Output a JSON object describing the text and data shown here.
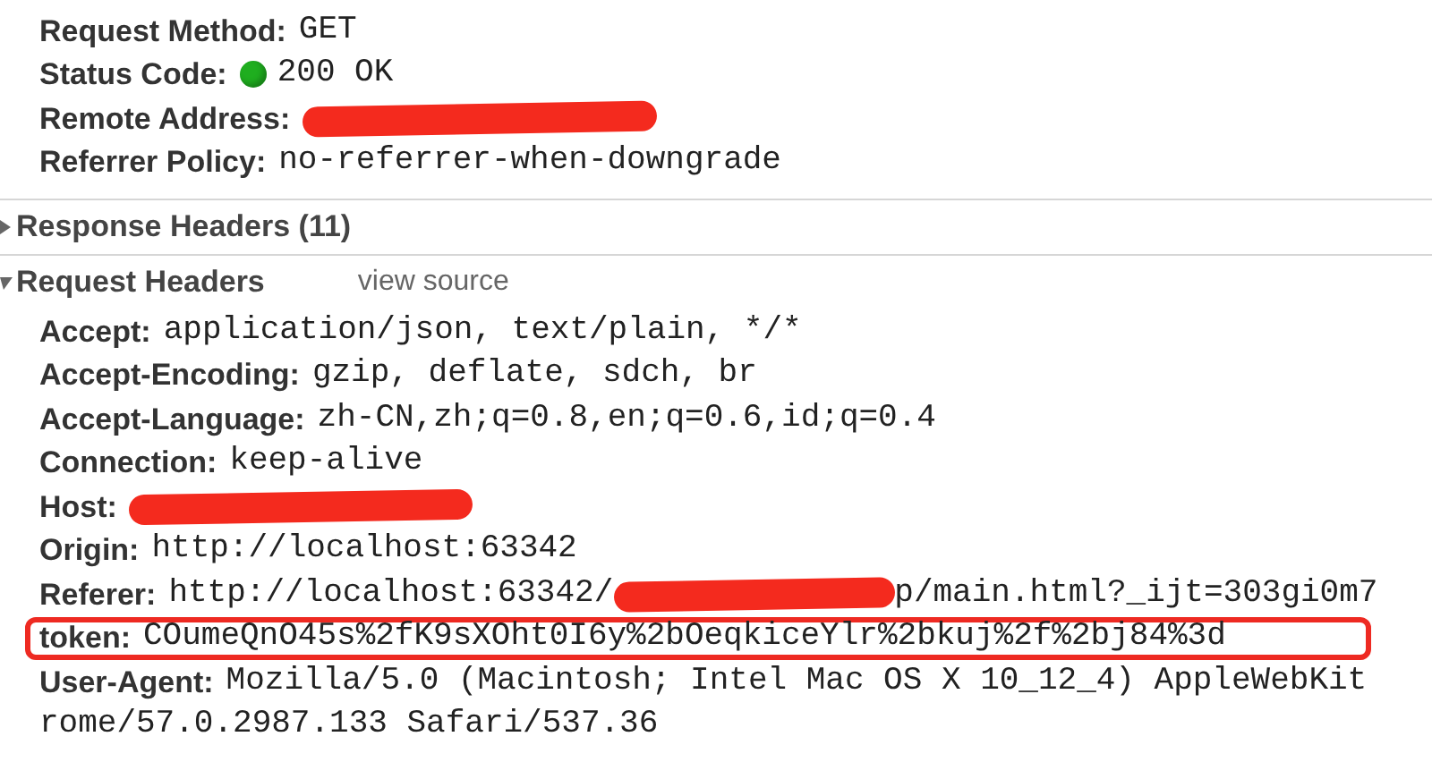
{
  "general": [
    {
      "label": "Request Method:",
      "value": "GET"
    },
    {
      "label": "Status Code:",
      "value": "200 OK",
      "color": "#1fae1f"
    },
    {
      "label": "Remote Address:",
      "redacted": true
    },
    {
      "label": "Referrer Policy:",
      "value": "no-referrer-when-downgrade"
    }
  ],
  "sections": [
    {
      "title": "Response Headers (11)",
      "expanded": false
    },
    {
      "title": "Request Headers",
      "expanded": true,
      "link": "view source",
      "headers": [
        {
          "label": "Accept:",
          "value": "application/json, text/plain, */*"
        },
        {
          "label": "Accept-Encoding:",
          "value": "gzip, deflate, sdch, br"
        },
        {
          "label": "Accept-Language:",
          "value": "zh-CN,zh;q=0.8,en;q=0.6,id;q=0.4"
        },
        {
          "label": "Connection:",
          "value": "keep-alive"
        },
        {
          "label": "Host:",
          "redacted": true
        },
        {
          "label": "Origin:",
          "value": "http://localhost:63342"
        },
        {
          "label": "Referer:",
          "value": "http://localhost:63342/",
          "redacted": true,
          "value_after": "p/main.html?_ijt=303gi0m7"
        },
        {
          "label": "token:",
          "value": "COumeQnO45s%2fK9sXOht0I6y%2bOeqkiceYlr%2bkuj%2f%2bj84%3d",
          "highlighted": true
        },
        {
          "label": "User-Agent:",
          "value": "Mozilla/5.0 (Macintosh; Intel Mac OS X 10_12_4) AppleWebKit",
          "continuation": "rome/57.0.2987.133 Safari/537.36"
        }
      ]
    }
  ]
}
